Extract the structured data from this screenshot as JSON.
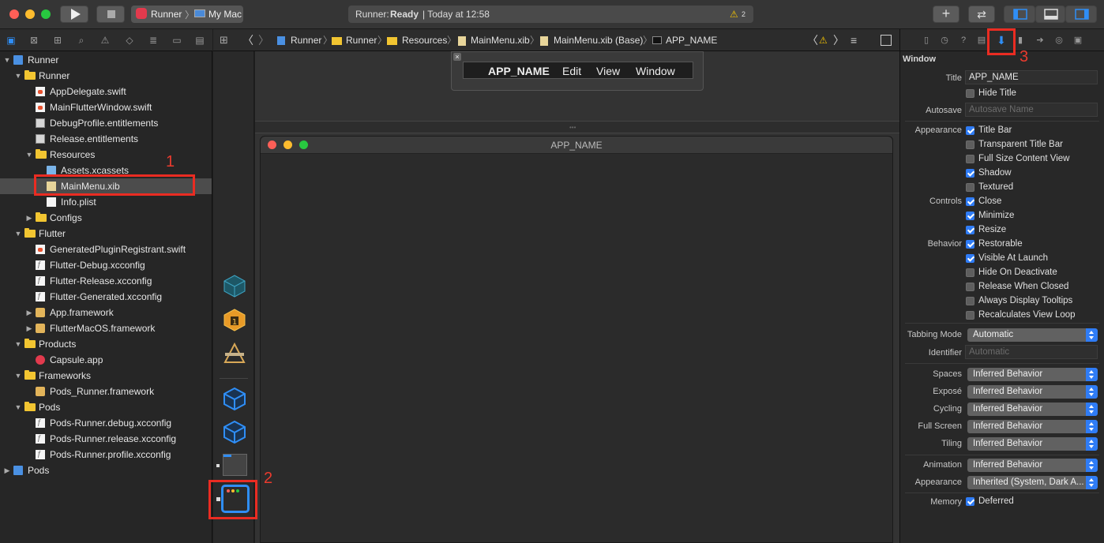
{
  "toolbar": {
    "scheme": "Runner",
    "device": "My Mac",
    "status_app": "Runner:",
    "status_state": "Ready",
    "status_time": "| Today at 12:58",
    "warning_count": "2"
  },
  "nav_tree": [
    {
      "label": "Runner",
      "indent": 0,
      "icon": "proj",
      "disc": "open"
    },
    {
      "label": "Runner",
      "indent": 1,
      "icon": "folder",
      "disc": "open"
    },
    {
      "label": "AppDelegate.swift",
      "indent": 2,
      "icon": "swift",
      "disc": ""
    },
    {
      "label": "MainFlutterWindow.swift",
      "indent": 2,
      "icon": "swift",
      "disc": ""
    },
    {
      "label": "DebugProfile.entitlements",
      "indent": 2,
      "icon": "ent",
      "disc": ""
    },
    {
      "label": "Release.entitlements",
      "indent": 2,
      "icon": "ent",
      "disc": ""
    },
    {
      "label": "Resources",
      "indent": 2,
      "icon": "folder",
      "disc": "open"
    },
    {
      "label": "Assets.xcassets",
      "indent": 3,
      "icon": "asset",
      "disc": ""
    },
    {
      "label": "MainMenu.xib",
      "indent": 3,
      "icon": "xib",
      "disc": "",
      "selected": true
    },
    {
      "label": "Info.plist",
      "indent": 3,
      "icon": "plist",
      "disc": ""
    },
    {
      "label": "Configs",
      "indent": 2,
      "icon": "folder",
      "disc": "closed"
    },
    {
      "label": "Flutter",
      "indent": 1,
      "icon": "folder",
      "disc": "open"
    },
    {
      "label": "GeneratedPluginRegistrant.swift",
      "indent": 2,
      "icon": "swift",
      "disc": ""
    },
    {
      "label": "Flutter-Debug.xcconfig",
      "indent": 2,
      "icon": "cfg",
      "disc": ""
    },
    {
      "label": "Flutter-Release.xcconfig",
      "indent": 2,
      "icon": "cfg",
      "disc": ""
    },
    {
      "label": "Flutter-Generated.xcconfig",
      "indent": 2,
      "icon": "cfg",
      "disc": ""
    },
    {
      "label": "App.framework",
      "indent": 2,
      "icon": "fw",
      "disc": "closed"
    },
    {
      "label": "FlutterMacOS.framework",
      "indent": 2,
      "icon": "fw",
      "disc": "closed"
    },
    {
      "label": "Products",
      "indent": 1,
      "icon": "folder",
      "disc": "open"
    },
    {
      "label": "Capsule.app",
      "indent": 2,
      "icon": "app",
      "disc": ""
    },
    {
      "label": "Frameworks",
      "indent": 1,
      "icon": "folder",
      "disc": "open"
    },
    {
      "label": "Pods_Runner.framework",
      "indent": 2,
      "icon": "fw",
      "disc": ""
    },
    {
      "label": "Pods",
      "indent": 1,
      "icon": "folder",
      "disc": "open"
    },
    {
      "label": "Pods-Runner.debug.xcconfig",
      "indent": 2,
      "icon": "cfg",
      "disc": ""
    },
    {
      "label": "Pods-Runner.release.xcconfig",
      "indent": 2,
      "icon": "cfg",
      "disc": ""
    },
    {
      "label": "Pods-Runner.profile.xcconfig",
      "indent": 2,
      "icon": "cfg",
      "disc": ""
    },
    {
      "label": "Pods",
      "indent": 0,
      "icon": "proj",
      "disc": "closed"
    }
  ],
  "jumpbar": {
    "crumb1": "Runner",
    "crumb2": "Runner",
    "crumb3": "Resources",
    "crumb4": "MainMenu.xib",
    "crumb5": "MainMenu.xib (Base)",
    "crumb6": "APP_NAME"
  },
  "menu": {
    "app": "APP_NAME",
    "edit": "Edit",
    "view": "View",
    "window": "Window"
  },
  "window_title": "APP_NAME",
  "inspector": {
    "section": "Window",
    "title_label": "Title",
    "title_value": "APP_NAME",
    "hide_title": "Hide Title",
    "autosave_label": "Autosave",
    "autosave_placeholder": "Autosave Name",
    "appearance_label": "Appearance",
    "controls_label": "Controls",
    "behavior_label": "Behavior",
    "checkboxes": [
      {
        "label": "Title Bar",
        "checked": true
      },
      {
        "label": "Transparent Title Bar",
        "checked": false
      },
      {
        "label": "Full Size Content View",
        "checked": false
      },
      {
        "label": "Shadow",
        "checked": true
      },
      {
        "label": "Textured",
        "checked": false
      },
      {
        "label": "Close",
        "checked": true
      },
      {
        "label": "Minimize",
        "checked": true
      },
      {
        "label": "Resize",
        "checked": true
      },
      {
        "label": "Restorable",
        "checked": true
      },
      {
        "label": "Visible At Launch",
        "checked": true
      },
      {
        "label": "Hide On Deactivate",
        "checked": false
      },
      {
        "label": "Release When Closed",
        "checked": false
      },
      {
        "label": "Always Display Tooltips",
        "checked": false
      },
      {
        "label": "Recalculates View Loop",
        "checked": false
      }
    ],
    "tabbing_label": "Tabbing Mode",
    "tabbing_value": "Automatic",
    "identifier_label": "Identifier",
    "identifier_placeholder": "Automatic",
    "spaces_label": "Spaces",
    "spaces_value": "Inferred Behavior",
    "expose_label": "Exposé",
    "expose_value": "Inferred Behavior",
    "cycling_label": "Cycling",
    "cycling_value": "Inferred Behavior",
    "fullscreen_label": "Full Screen",
    "fullscreen_value": "Inferred Behavior",
    "tiling_label": "Tiling",
    "tiling_value": "Inferred Behavior",
    "animation_label": "Animation",
    "animation_value": "Inferred Behavior",
    "appearance2_label": "Appearance",
    "appearance2_value": "Inherited (System, Dark A...",
    "memory_label": "Memory",
    "memory_value": "Deferred",
    "memory_checked": true
  },
  "annotations": {
    "n1": "1",
    "n2": "2",
    "n3": "3",
    "color": "#ea2c22"
  }
}
